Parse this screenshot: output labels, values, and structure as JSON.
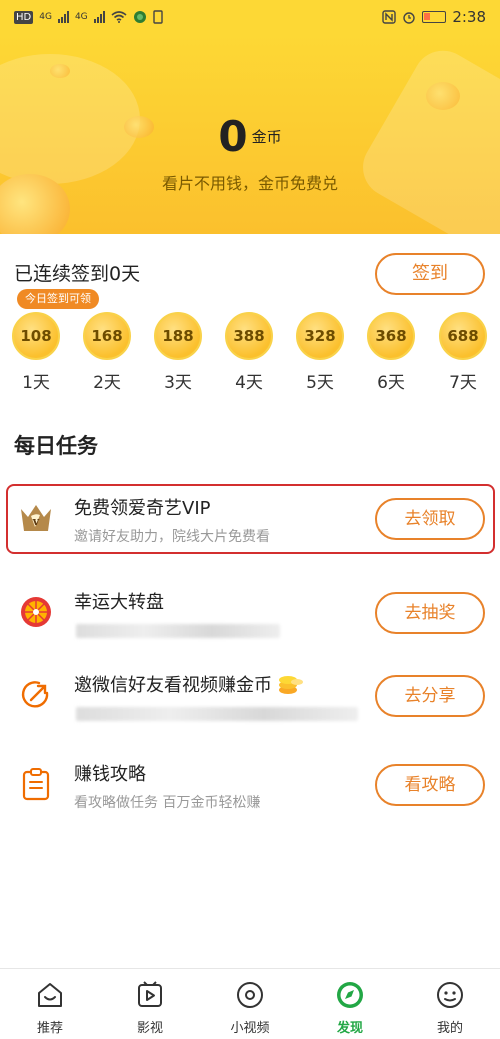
{
  "status_bar": {
    "left_badge": "HD",
    "net1": "4G",
    "net2": "4G",
    "time": "2:38"
  },
  "hero": {
    "coin_value": "0",
    "coin_unit": "金币",
    "subtitle": "看片不用钱，金币免费兑"
  },
  "checkin": {
    "title": "已连续签到0天",
    "button": "签到",
    "today_tag": "今日签到可领",
    "days": [
      {
        "amount": "108",
        "label": "1天"
      },
      {
        "amount": "168",
        "label": "2天"
      },
      {
        "amount": "188",
        "label": "3天"
      },
      {
        "amount": "388",
        "label": "4天"
      },
      {
        "amount": "328",
        "label": "5天"
      },
      {
        "amount": "368",
        "label": "6天"
      },
      {
        "amount": "688",
        "label": "7天"
      }
    ]
  },
  "tasks": {
    "section_title": "每日任务",
    "items": [
      {
        "title": "免费领爱奇艺VIP",
        "subtitle": "邀请好友助力，院线大片免费看",
        "button": "去领取",
        "icon": "vip-crown-icon"
      },
      {
        "title": "幸运大转盘",
        "subtitle": "",
        "button": "去抽奖",
        "icon": "lucky-wheel-icon"
      },
      {
        "title": "邀微信好友看视频赚金币",
        "subtitle": "",
        "button": "去分享",
        "icon": "share-arrow-icon"
      },
      {
        "title": "赚钱攻略",
        "subtitle": "看攻略做任务 百万金币轻松赚",
        "button": "看攻略",
        "icon": "clipboard-icon"
      }
    ]
  },
  "bottom_nav": {
    "items": [
      {
        "label": "推荐",
        "icon": "home-smile-icon"
      },
      {
        "label": "影视",
        "icon": "video-play-icon"
      },
      {
        "label": "小视频",
        "icon": "disc-icon"
      },
      {
        "label": "发现",
        "icon": "compass-icon",
        "active": true
      },
      {
        "label": "我的",
        "icon": "profile-face-icon"
      }
    ]
  },
  "colors": {
    "brand_yellow": "#fdd835",
    "accent_orange": "#e8822a",
    "active_green": "#22a745",
    "highlight_red": "#d32f2f"
  }
}
